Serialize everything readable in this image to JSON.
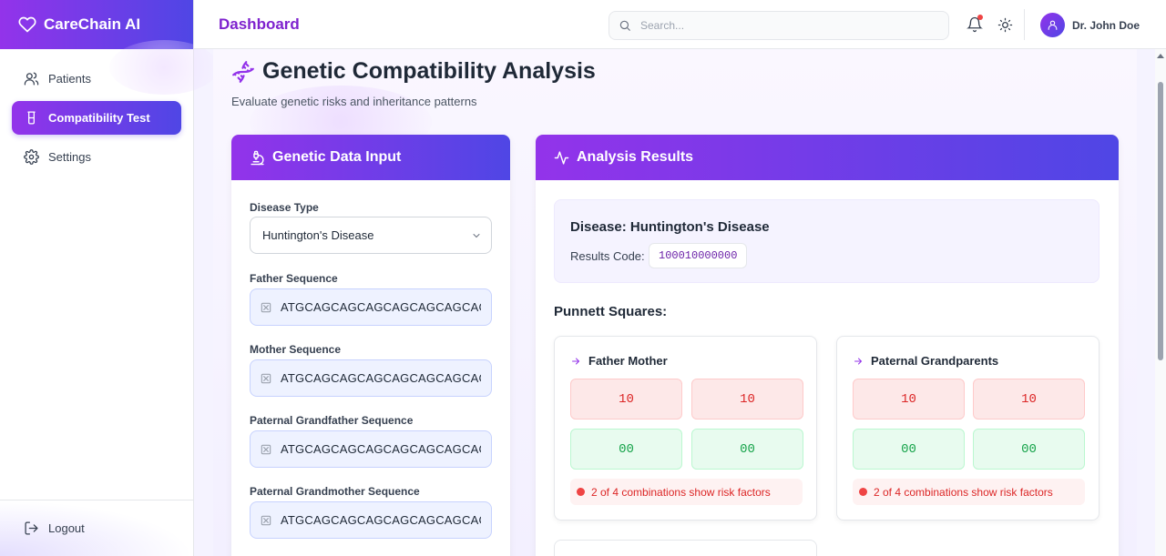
{
  "app": {
    "name": "CareChain AI"
  },
  "sidebar": {
    "items": [
      {
        "label": "Patients",
        "icon": "users-icon",
        "active": false
      },
      {
        "label": "Compatibility Test",
        "icon": "beaker-icon",
        "active": true
      },
      {
        "label": "Settings",
        "icon": "gear-icon",
        "active": false
      }
    ],
    "logout_label": "Logout"
  },
  "header": {
    "title": "Dashboard",
    "search_placeholder": "Search...",
    "user_name": "Dr. John Doe",
    "notification_dot": true
  },
  "page": {
    "title": "Genetic Compatibility Analysis",
    "subtitle": "Evaluate genetic risks and inheritance patterns"
  },
  "input_card": {
    "title": "Genetic Data Input",
    "disease_label": "Disease Type",
    "disease_value": "Huntington's Disease",
    "fields": [
      {
        "label": "Father Sequence",
        "value": "ATGCAGCAGCAGCAGCAGCAGCAGCAGCAG"
      },
      {
        "label": "Mother Sequence",
        "value": "ATGCAGCAGCAGCAGCAGCAGCAGCAGCAG"
      },
      {
        "label": "Paternal Grandfather Sequence",
        "value": "ATGCAGCAGCAGCAGCAGCAGCAGCAGCAG"
      },
      {
        "label": "Paternal Grandmother Sequence",
        "value": "ATGCAGCAGCAGCAGCAGCAGCAGCAGCAG"
      }
    ]
  },
  "results_card": {
    "title": "Analysis Results",
    "disease_line": "Disease: Huntington's Disease",
    "code_label": "Results Code:",
    "code_value": "100010000000",
    "punnett_title": "Punnett Squares:",
    "squares": [
      {
        "title": "Father Mother",
        "cells": [
          "10",
          "10",
          "00",
          "00"
        ],
        "note": "2 of 4 combinations show risk factors"
      },
      {
        "title": "Paternal Grandparents",
        "cells": [
          "10",
          "10",
          "00",
          "00"
        ],
        "note": "2 of 4 combinations show risk factors"
      }
    ]
  },
  "colors": {
    "accent_start": "#9333ea",
    "accent_end": "#4f46e5",
    "risk": "#dc2626",
    "safe": "#16a34a"
  }
}
